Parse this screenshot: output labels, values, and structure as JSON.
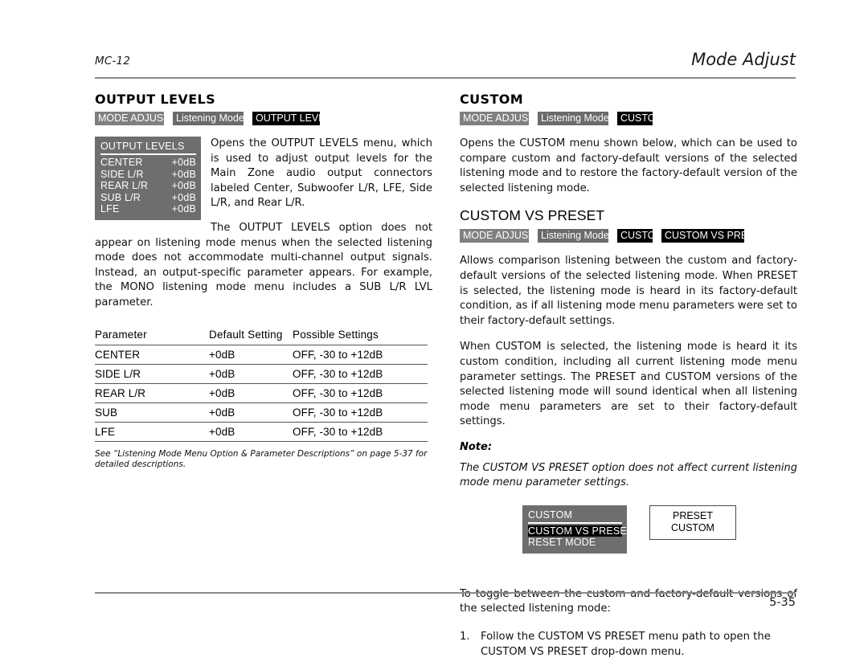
{
  "header": {
    "left": "MC-12",
    "right": "Mode Adjust"
  },
  "footer": {
    "page": "5-35"
  },
  "left_column": {
    "section_title": "OUTPUT LEVELS",
    "breadcrumbs": [
      "MODE ADJUST",
      "Listening Mode",
      "OUTPUT LEVELS"
    ],
    "osd_menu": {
      "title": "OUTPUT LEVELS",
      "rows": [
        {
          "label": "CENTER",
          "value": "+0dB"
        },
        {
          "label": "SIDE L/R",
          "value": "+0dB"
        },
        {
          "label": "REAR L/R",
          "value": "+0dB"
        },
        {
          "label": "SUB L/R",
          "value": "+0dB"
        },
        {
          "label": "LFE",
          "value": "+0dB"
        }
      ]
    },
    "paragraph_1": "Opens the OUTPUT LEVELS menu, which is used to adjust output levels for the Main Zone audio output connectors labeled Center, Subwoofer L/R, LFE, Side L/R, and Rear L/R.",
    "paragraph_2": "The OUTPUT LEVELS option does not appear on listening mode menus when the selected listening mode does not accommodate multi-channel output signals. Instead, an output-specific parameter appears. For example, the MONO listening mode menu includes a SUB L/R LVL parameter.",
    "table": {
      "headers": [
        "Parameter",
        "Default Setting",
        "Possible Settings"
      ],
      "rows": [
        [
          "CENTER",
          "+0dB",
          "OFF, -30 to +12dB"
        ],
        [
          "SIDE L/R",
          "+0dB",
          "OFF, -30 to +12dB"
        ],
        [
          "REAR L/R",
          "+0dB",
          "OFF, -30 to +12dB"
        ],
        [
          "SUB",
          "+0dB",
          "OFF, -30 to +12dB"
        ],
        [
          "LFE",
          "+0dB",
          "OFF, -30 to +12dB"
        ]
      ]
    },
    "caption": "See “Listening Mode Menu Option & Parameter Descriptions” on page 5-37 for detailed descriptions."
  },
  "right_column": {
    "section_title": "CUSTOM",
    "breadcrumbs": [
      "MODE ADJUST",
      "Listening Mode",
      "CUSTOM"
    ],
    "paragraph_1": "Opens the CUSTOM menu shown below, which can be used to compare custom and factory-default versions of the selected listening mode and to restore the factory-default version of the selected listening mode.",
    "sub_title": "CUSTOM VS PRESET",
    "sub_breadcrumbs": [
      "MODE ADJUST",
      "Listening Mode",
      "CUSTOM",
      "CUSTOM VS PRESET"
    ],
    "paragraph_2": "Allows comparison listening between the custom and factory-default versions of the selected listening mode. When PRESET is selected, the listening mode is heard in its factory-default condition, as if all listening mode menu parameters were set to their factory-default settings.",
    "paragraph_3": "When CUSTOM is selected, the listening mode is heard it its custom condition, including all current listening mode menu parameter settings. The PRESET and CUSTOM versions of the selected listening mode will sound identical when all listening mode menu parameters are set to their factory-default settings.",
    "note_label": "Note:",
    "note_text": "The CUSTOM VS PRESET option does not affect current listening mode menu parameter settings.",
    "osd_menu": {
      "title": "CUSTOM",
      "rows": [
        {
          "label": "CUSTOM VS PRESET",
          "selected": true
        },
        {
          "label": "RESET MODE",
          "selected": false
        }
      ]
    },
    "dropdown": {
      "options": [
        "PRESET",
        "CUSTOM"
      ]
    },
    "paragraph_4": "To toggle between the custom and factory-default versions of the selected listening mode:",
    "steps": [
      {
        "num": "1.",
        "text": "Follow the CUSTOM VS PRESET menu path to open the CUSTOM VS PRESET drop-down menu."
      }
    ]
  },
  "colors": {
    "crumb_level1": "#808080",
    "crumb_level2": "#6b6b6b",
    "crumb_active": "#000000",
    "osd_background": "#6e6e6e",
    "rule": "#8a8a8a"
  }
}
